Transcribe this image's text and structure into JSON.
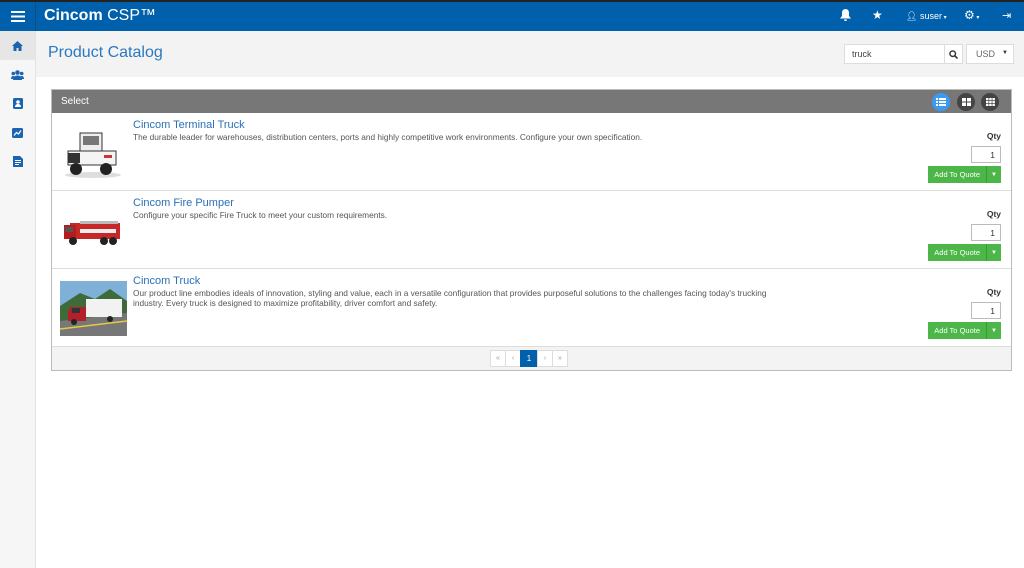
{
  "app": {
    "brand_bold": "Cincom",
    "brand_rest": " CSP™",
    "user": "suser"
  },
  "sidebar": {
    "items": [
      "home",
      "users",
      "contacts",
      "reports",
      "documents"
    ]
  },
  "page": {
    "title": "Product Catalog",
    "search_value": "truck",
    "currency": "USD"
  },
  "panel": {
    "header": "Select",
    "view_modes": [
      "list",
      "grid-large",
      "grid-small"
    ],
    "active_view": "list"
  },
  "products": [
    {
      "name": "Cincom Terminal Truck",
      "description": "The durable leader for warehouses, distribution centers, ports and highly competitive work environments. Configure your own specification.",
      "qty_label": "Qty",
      "qty": "1",
      "button": "Add To Quote"
    },
    {
      "name": "Cincom Fire Pumper",
      "description": "Configure your specific Fire Truck to meet your custom requirements.",
      "qty_label": "Qty",
      "qty": "1",
      "button": "Add To Quote"
    },
    {
      "name": "Cincom Truck",
      "description": "Our product line embodies ideals of innovation, styling and value, each in a versatile configuration that provides purposeful solutions to the challenges facing today's trucking industry. Every truck is designed to maximize profitability, driver comfort and safety.",
      "qty_label": "Qty",
      "qty": "1",
      "button": "Add To Quote"
    }
  ],
  "pagination": {
    "first": "«",
    "prev": "‹",
    "current": "1",
    "next": "›",
    "last": "»"
  },
  "colors": {
    "brand": "#0060ac",
    "accent_button": "#4cb748",
    "link": "#2a6fb5"
  }
}
